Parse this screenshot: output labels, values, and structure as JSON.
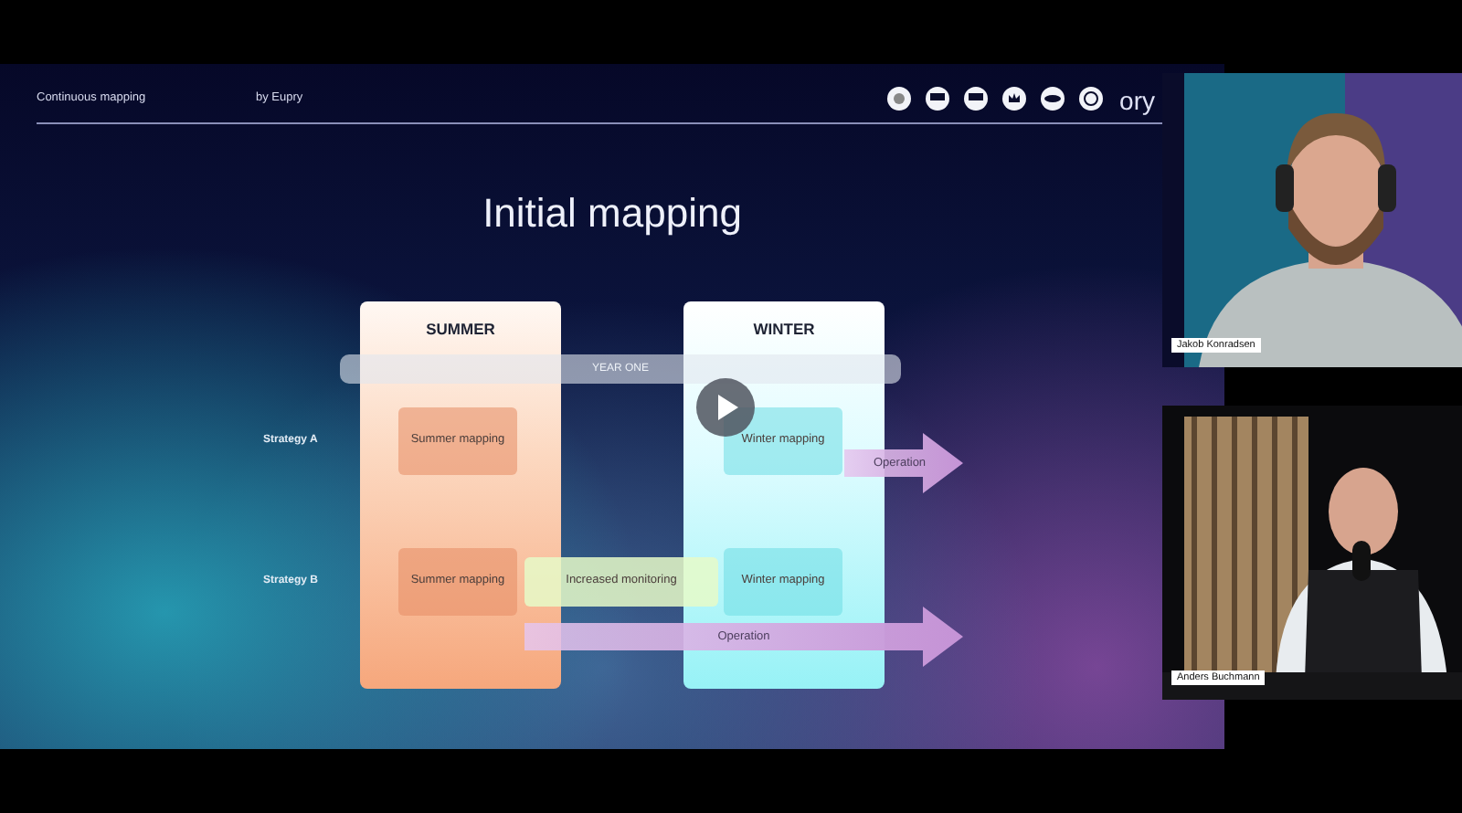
{
  "slide": {
    "header_left": "Continuous mapping",
    "header_center": "by Eupry",
    "logos": [
      {
        "kind": "seal"
      },
      {
        "kind": "iso"
      },
      {
        "kind": "iso"
      },
      {
        "kind": "crown"
      },
      {
        "kind": "oval"
      },
      {
        "kind": "globe"
      }
    ],
    "brand_fragment": "ory",
    "title": "Initial mapping",
    "columns": [
      {
        "label": "SUMMER",
        "kind": "summer"
      },
      {
        "label": "WINTER",
        "kind": "winter"
      }
    ],
    "timeline": "YEAR ONE",
    "rows": [
      {
        "label": "Strategy A",
        "summer": "Summer mapping",
        "winter": "Winter mapping",
        "operation": "Operation"
      },
      {
        "label": "Strategy B",
        "summer": "Summer mapping",
        "bridge": "Increased monitoring",
        "winter": "Winter mapping",
        "operation": "Operation"
      }
    ]
  },
  "participants": [
    {
      "name": "Jakob Konradsen",
      "kind": "headset"
    },
    {
      "name": "Anders Buchmann",
      "kind": "studio"
    }
  ]
}
